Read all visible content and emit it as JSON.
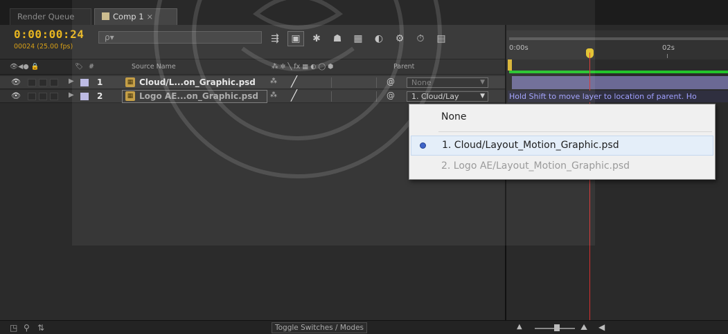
{
  "tabs": [
    {
      "label": "Render Queue"
    },
    {
      "label": "Comp 1",
      "close": "×"
    }
  ],
  "header": {
    "timecode": "0:00:00:24",
    "frame_info": "00024 (25.00 fps)",
    "search_placeholder": "ρ▾"
  },
  "columns": {
    "source_name": "Source Name",
    "number": "#",
    "parent": "Parent"
  },
  "layers": [
    {
      "number": "1",
      "name": "Cloud/L...on_Graphic.psd",
      "parent": "None",
      "label_color": "#b9b7e3"
    },
    {
      "number": "2",
      "name": "Logo AE...on_Graphic.psd",
      "parent": "1. Cloud/Lay",
      "label_color": "#b9b7e3"
    }
  ],
  "timeline": {
    "tick_0": "0:00s",
    "tick_2": "02s",
    "hint": "Hold Shift to move layer to location of parent. Ho"
  },
  "parent_dropdown": {
    "options": [
      {
        "label": "None"
      },
      {
        "label": "1. Cloud/Layout_Motion_Graphic.psd",
        "selected": true
      },
      {
        "label": "2. Logo AE/Layout_Motion_Graphic.psd",
        "disabled": true
      }
    ]
  },
  "footer": {
    "toggle_label": "Toggle Switches / Modes"
  },
  "colors": {
    "timecode": "#e7b520",
    "layer_bar": "#6b6994",
    "work_area_green": "#22c42a",
    "cti_red": "#d83030"
  }
}
